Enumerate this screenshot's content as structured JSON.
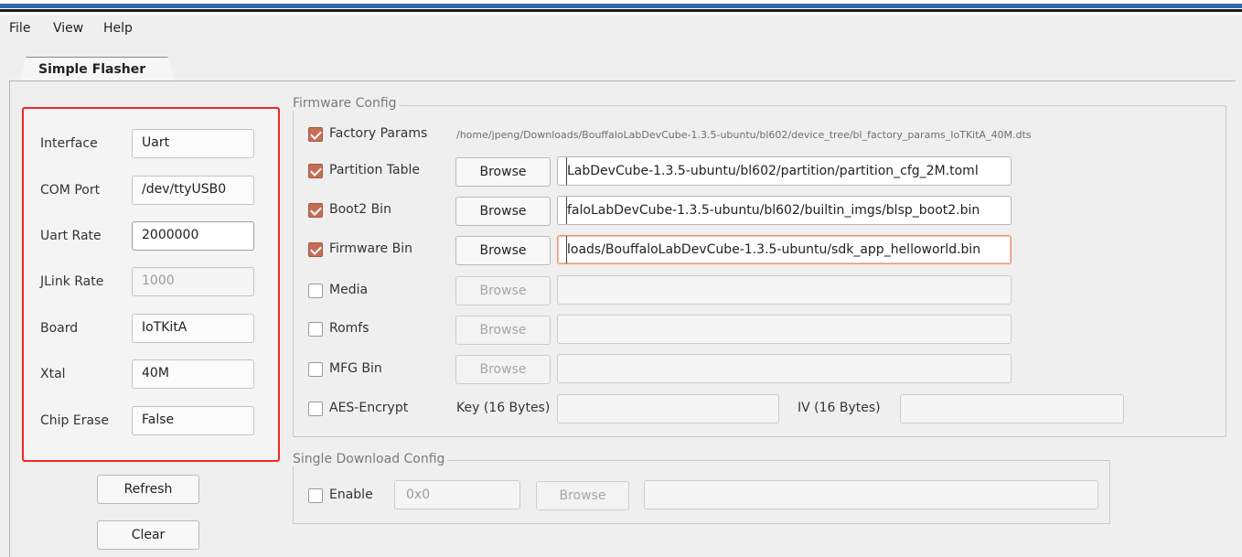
{
  "menu": {
    "file": "File",
    "view": "View",
    "help": "Help"
  },
  "tab": {
    "label": "Simple Flasher"
  },
  "left_panel": {
    "fields": [
      {
        "label": "Interface",
        "value": "Uart"
      },
      {
        "label": "COM Port",
        "value": "/dev/ttyUSB0"
      },
      {
        "label": "Uart Rate",
        "value": "2000000"
      },
      {
        "label": "JLink Rate",
        "value": "1000"
      },
      {
        "label": "Board",
        "value": "IoTKitA"
      },
      {
        "label": "Xtal",
        "value": "40M"
      },
      {
        "label": "Chip Erase",
        "value": "False"
      }
    ],
    "refresh_label": "Refresh",
    "clear_label": "Clear"
  },
  "firmware_config": {
    "title": "Firmware Config",
    "rows": [
      {
        "label": "Factory Params",
        "checked": true,
        "path": "/home/jpeng/Downloads/BouffaloLabDevCube-1.3.5-ubuntu/bl602/device_tree/bl_factory_params_IoTKitA_40M.dts"
      },
      {
        "label": "Partition Table",
        "checked": true,
        "browse": "Browse",
        "path": "LabDevCube-1.3.5-ubuntu/bl602/partition/partition_cfg_2M.toml"
      },
      {
        "label": "Boot2 Bin",
        "checked": true,
        "browse": "Browse",
        "path": "faloLabDevCube-1.3.5-ubuntu/bl602/builtin_imgs/blsp_boot2.bin"
      },
      {
        "label": "Firmware Bin",
        "checked": true,
        "browse": "Browse",
        "path": "loads/BouffaloLabDevCube-1.3.5-ubuntu/sdk_app_helloworld.bin"
      },
      {
        "label": "Media",
        "checked": false,
        "browse": "Browse",
        "path": ""
      },
      {
        "label": "Romfs",
        "checked": false,
        "browse": "Browse",
        "path": ""
      },
      {
        "label": "MFG Bin",
        "checked": false,
        "browse": "Browse",
        "path": ""
      }
    ],
    "aes": {
      "label": "AES-Encrypt",
      "checked": false,
      "key_label": "Key (16 Bytes)",
      "key_value": "",
      "iv_label": "IV (16 Bytes)",
      "iv_value": ""
    }
  },
  "single_download": {
    "title": "Single Download Config",
    "enable_label": "Enable",
    "enabled": false,
    "address_placeholder": "0x0",
    "browse": "Browse",
    "path": ""
  },
  "colors": {
    "accent_check": "#c56e55",
    "highlight_border": "#ee2a24",
    "focus_border": "#e8946a"
  }
}
